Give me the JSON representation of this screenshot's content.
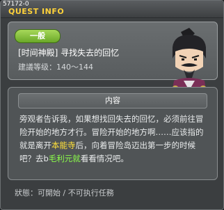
{
  "window": {
    "quest_id": "57172-0",
    "title": "QUEST INFO"
  },
  "quest": {
    "category_badge": "一般",
    "name": "[时间神殿] 寻找失去的回忆",
    "level_range": "建議等级：140～144"
  },
  "details": {
    "section_title": "内容",
    "description_segments": [
      {
        "text": "旁观者告诉我，如果想找回失去的回忆，必须前往冒险开始的地方才行。冒险开始的地方啊……应该指的就是离开",
        "style": "normal"
      },
      {
        "text": "本能寺",
        "style": "yellow"
      },
      {
        "text": "后，向着冒险岛迈出第一步的时候吧？去b",
        "style": "normal"
      },
      {
        "text": "毛利元就",
        "style": "green"
      },
      {
        "text": "看看情况吧。",
        "style": "normal"
      }
    ]
  },
  "status": {
    "text": "狀態：可開始 / 不可执行任務"
  },
  "colors": {
    "title": "#ffd23a",
    "badge": "#8cc43f",
    "highlight_place": "#ffe13a",
    "highlight_npc": "#8cff4a"
  },
  "icons": {
    "npc_portrait": "samurai-npc-portrait"
  }
}
